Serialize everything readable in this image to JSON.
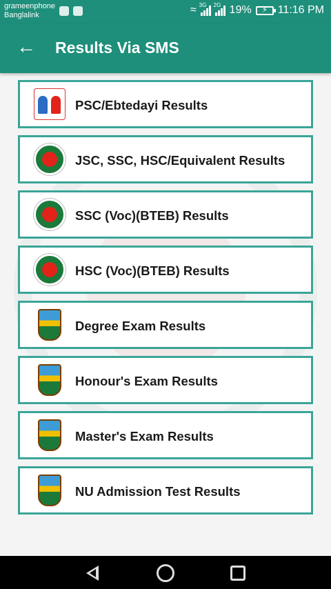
{
  "status_bar": {
    "carrier_1": "grameenphone",
    "carrier_2": "Banglalink",
    "network_1": "3G",
    "network_2": "2G",
    "battery": "19%",
    "time": "11:16 PM"
  },
  "app_bar": {
    "title": "Results Via SMS",
    "back_icon": "arrow-left-icon"
  },
  "results": [
    {
      "label": "PSC/Ebtedayi Results",
      "icon": "psc-logo-icon"
    },
    {
      "label": "JSC, SSC, HSC/Equivalent Results",
      "icon": "government-seal-icon"
    },
    {
      "label": "SSC (Voc)(BTEB) Results",
      "icon": "government-seal-icon"
    },
    {
      "label": "HSC (Voc)(BTEB) Results",
      "icon": "government-seal-icon"
    },
    {
      "label": "Degree Exam Results",
      "icon": "national-university-crest-icon"
    },
    {
      "label": "Honour's Exam Results",
      "icon": "national-university-crest-icon"
    },
    {
      "label": "Master's Exam Results",
      "icon": "national-university-crest-icon"
    },
    {
      "label": "NU Admission Test Results",
      "icon": "national-university-crest-icon"
    }
  ],
  "colors": {
    "primary": "#1e8f7b",
    "card_border": "#3aa597"
  }
}
